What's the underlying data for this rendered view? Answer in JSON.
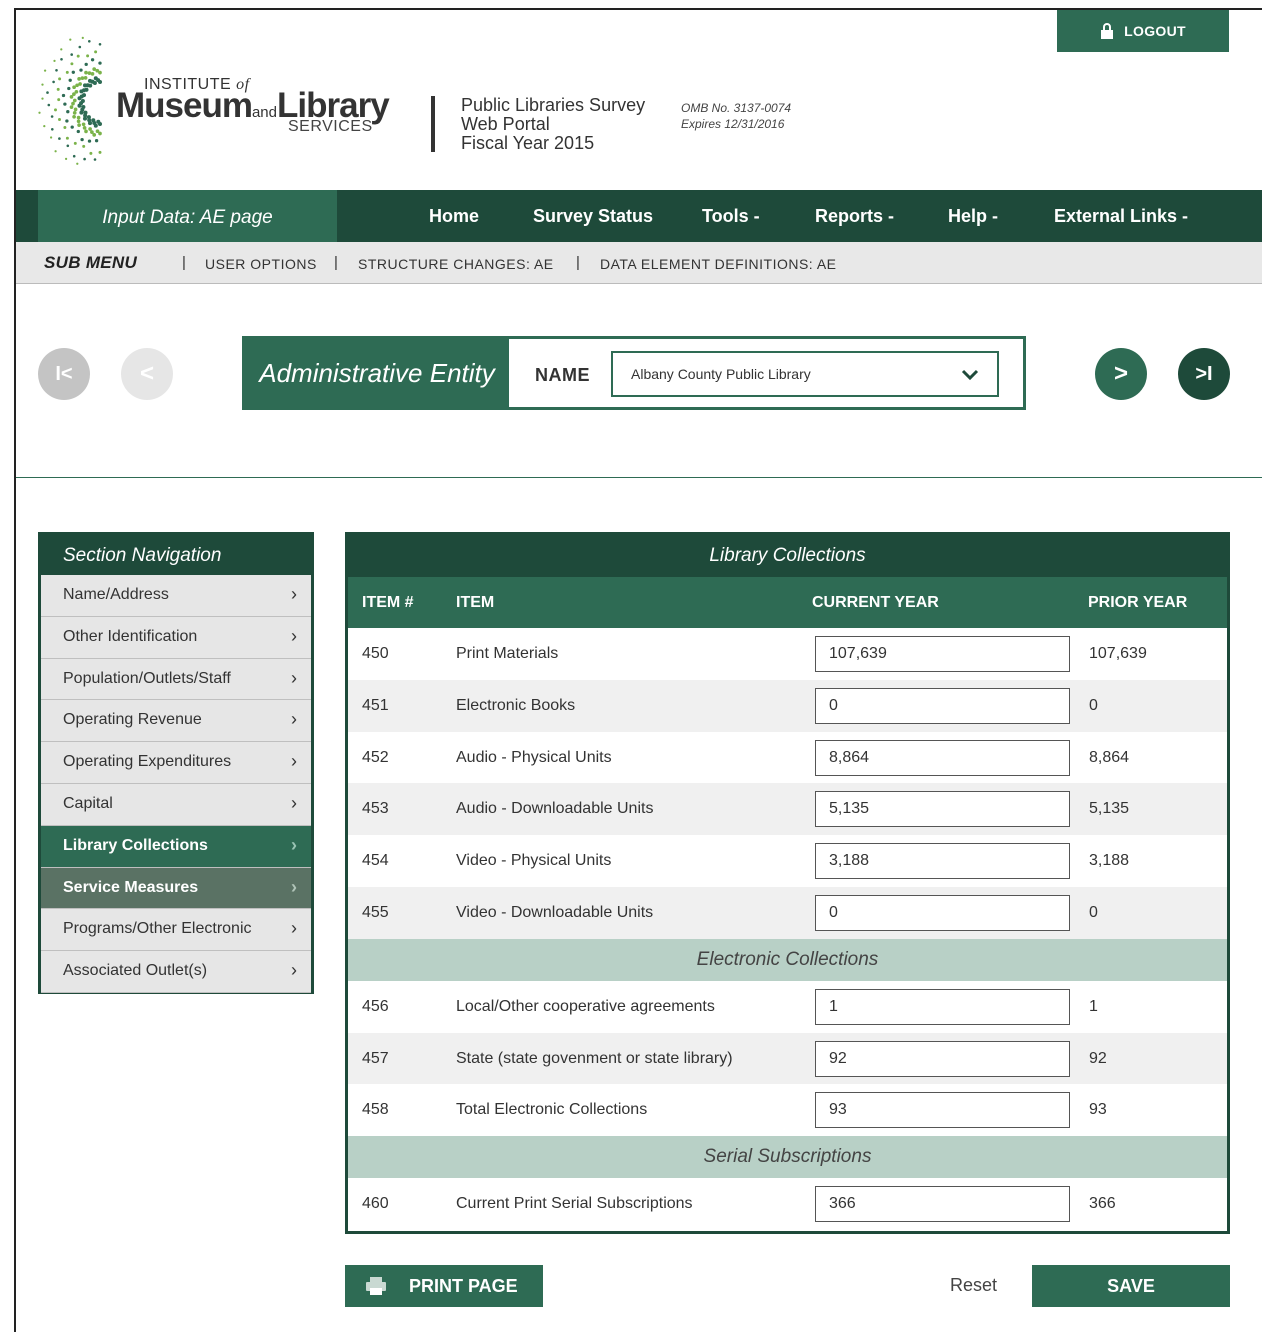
{
  "header": {
    "logout_label": "LOGOUT",
    "logo": {
      "top": "INSTITUTE",
      "of": "of",
      "main_a": "Museum",
      "and": "and",
      "main_b": "Library",
      "bottom": "SERVICES"
    },
    "portal_line1": "Public Libraries Survey",
    "portal_line2": "Web Portal",
    "portal_line3": "Fiscal Year 2015",
    "omb_line1": "OMB No. 3137-0074",
    "omb_line2": "Expires 12/31/2016"
  },
  "nav": {
    "page_tag": "Input Data: AE page",
    "items": [
      "Home",
      "Survey Status",
      "Tools -",
      "Reports -",
      "Help -",
      "External Links -"
    ]
  },
  "submenu": {
    "title": "SUB MENU",
    "links": [
      "USER OPTIONS",
      "STRUCTURE CHANGES: AE",
      "DATA ELEMENT DEFINITIONS: AE"
    ],
    "separator": "|"
  },
  "entity": {
    "title": "Administrative Entity",
    "name_label": "NAME",
    "selected": "Albany County Public Library"
  },
  "pager": {
    "first_glyph": "I<",
    "prev_glyph": "<",
    "next_glyph": ">",
    "last_glyph": ">I"
  },
  "section_nav": {
    "title": "Section Navigation",
    "items": [
      "Name/Address",
      "Other Identification",
      "Population/Outlets/Staff",
      "Operating Revenue",
      "Operating Expenditures",
      "Capital",
      "Library Collections",
      "Service Measures",
      "Programs/Other Electronic",
      "Associated Outlet(s)"
    ],
    "active": "Library Collections",
    "arrow": "›"
  },
  "table": {
    "title": "Library Collections",
    "columns": [
      "ITEM #",
      "ITEM",
      "CURRENT YEAR",
      "PRIOR YEAR"
    ],
    "rows_a": [
      {
        "num": "450",
        "item": "Print Materials",
        "current": "107,639",
        "prior": "107,639"
      },
      {
        "num": "451",
        "item": "Electronic Books",
        "current": "0",
        "prior": "0"
      },
      {
        "num": "452",
        "item": "Audio - Physical Units",
        "current": "8,864",
        "prior": "8,864"
      },
      {
        "num": "453",
        "item": "Audio - Downloadable Units",
        "current": "5,135",
        "prior": "5,135"
      },
      {
        "num": "454",
        "item": "Video - Physical Units",
        "current": "3,188",
        "prior": "3,188"
      },
      {
        "num": "455",
        "item": "Video - Downloadable Units",
        "current": "0",
        "prior": "0"
      }
    ],
    "subhead_b": "Electronic Collections",
    "rows_b": [
      {
        "num": "456",
        "item": "Local/Other cooperative agreements",
        "current": "1",
        "prior": "1"
      },
      {
        "num": "457",
        "item": "State (state govenment or state library)",
        "current": "92",
        "prior": "92"
      },
      {
        "num": "458",
        "item": "Total Electronic Collections",
        "current": "93",
        "prior": "93"
      }
    ],
    "subhead_c": "Serial Subscriptions",
    "rows_c": [
      {
        "num": "460",
        "item": "Current Print Serial Subscriptions",
        "current": "366",
        "prior": "366"
      }
    ]
  },
  "actions": {
    "print_label": "PRINT PAGE",
    "reset_label": "Reset",
    "save_label": "SAVE"
  },
  "colors": {
    "brand_dark": "#1e4a3a",
    "brand": "#2e6b54",
    "subhead": "#b8d0c6"
  }
}
